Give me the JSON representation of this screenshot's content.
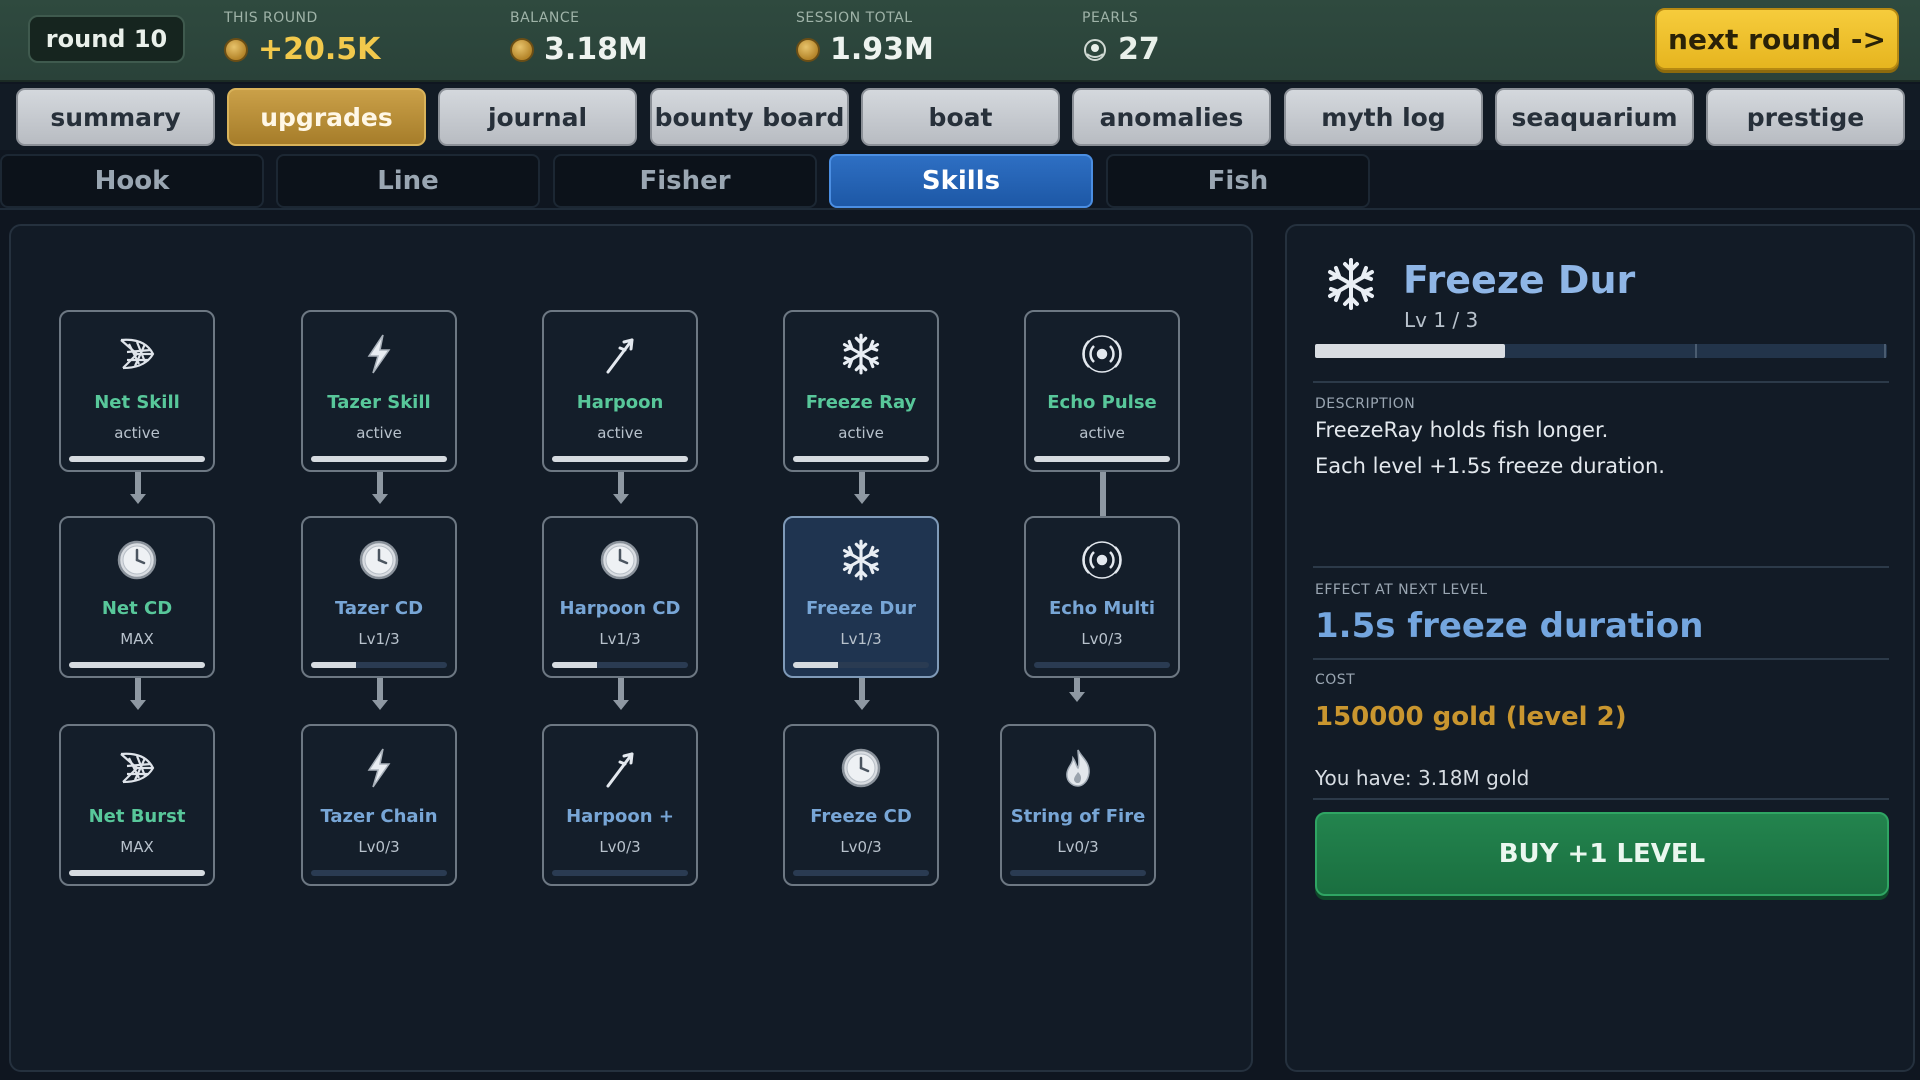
{
  "topbar": {
    "round": "round 10",
    "this_round": {
      "label": "THIS ROUND",
      "value": "+20.5K"
    },
    "balance": {
      "label": "BALANCE",
      "value": "3.18M"
    },
    "session_total": {
      "label": "SESSION TOTAL",
      "value": "1.93M"
    },
    "pearls": {
      "label": "PEARLS",
      "value": "27"
    },
    "next_round": "next round ->"
  },
  "main_tabs": [
    "summary",
    "upgrades",
    "journal",
    "bounty board",
    "boat",
    "anomalies",
    "myth log",
    "seaquarium",
    "prestige"
  ],
  "main_tab_active": "upgrades",
  "sub_tabs": [
    "Hook",
    "Line",
    "Fisher",
    "Skills",
    "Fish"
  ],
  "sub_tab_active": "Skills",
  "skill_tree": {
    "nodes": [
      {
        "name": "Net Skill",
        "status": "active",
        "icon": "net-icon",
        "progress": 1.0,
        "color": "green"
      },
      {
        "name": "Tazer Skill",
        "status": "active",
        "icon": "lightning-icon",
        "progress": 1.0,
        "color": "green"
      },
      {
        "name": "Harpoon",
        "status": "active",
        "icon": "harpoon-icon",
        "progress": 1.0,
        "color": "green"
      },
      {
        "name": "Freeze Ray",
        "status": "active",
        "icon": "snowflake-icon",
        "progress": 1.0,
        "color": "green"
      },
      {
        "name": "Echo Pulse",
        "status": "active",
        "icon": "echo-icon",
        "progress": 1.0,
        "color": "green"
      },
      {
        "name": "Net CD",
        "status": "MAX",
        "icon": "clock-icon",
        "progress": 1.0,
        "color": "green"
      },
      {
        "name": "Tazer CD",
        "status": "Lv1/3",
        "icon": "clock-icon",
        "progress": 0.333,
        "color": "blue"
      },
      {
        "name": "Harpoon CD",
        "status": "Lv1/3",
        "icon": "clock-icon",
        "progress": 0.333,
        "color": "blue"
      },
      {
        "name": "Freeze Dur",
        "status": "Lv1/3",
        "icon": "snowflake-icon",
        "progress": 0.333,
        "color": "blue",
        "selected": true
      },
      {
        "name": "Echo Multi",
        "status": "Lv0/3",
        "icon": "echo-icon",
        "progress": 0,
        "color": "blue"
      },
      {
        "name": "Net Burst",
        "status": "MAX",
        "icon": "net-icon",
        "progress": 1.0,
        "color": "green"
      },
      {
        "name": "Tazer Chain",
        "status": "Lv0/3",
        "icon": "lightning-icon",
        "progress": 0,
        "color": "blue"
      },
      {
        "name": "Harpoon +",
        "status": "Lv0/3",
        "icon": "harpoon-icon",
        "progress": 0,
        "color": "blue"
      },
      {
        "name": "Freeze CD",
        "status": "Lv0/3",
        "icon": "clock-icon",
        "progress": 0,
        "color": "blue"
      },
      {
        "name": "String of Fire",
        "status": "Lv0/3",
        "icon": "fire-icon",
        "progress": 0,
        "color": "blue"
      }
    ]
  },
  "detail": {
    "title": "Freeze Dur",
    "level_text": "Lv 1  /  3",
    "progress": 0.333,
    "description_label": "DESCRIPTION",
    "description_line1": "FreezeRay holds fish longer.",
    "description_line2": "Each level +1.5s freeze duration.",
    "effect_label": "EFFECT AT NEXT LEVEL",
    "effect_value": "1.5s freeze duration",
    "cost_label": "COST",
    "cost_value": "150000 gold  (level 2)",
    "you_have": "You have:  3.18M  gold",
    "buy_label": "BUY  +1  LEVEL"
  }
}
